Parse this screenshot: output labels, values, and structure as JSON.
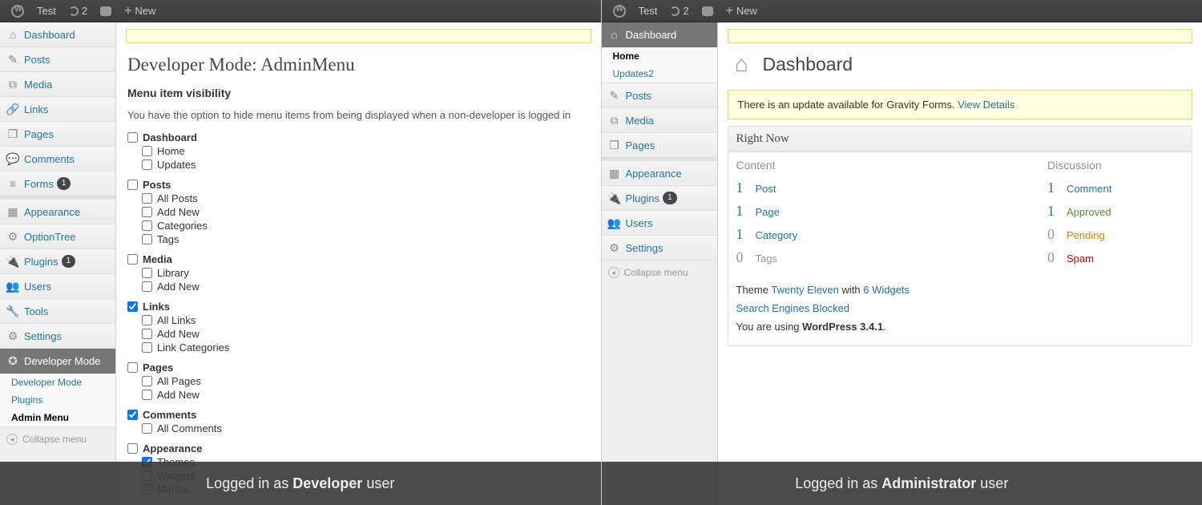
{
  "adminbar": {
    "site": "Test",
    "updates": "2",
    "new": "New"
  },
  "left": {
    "sidebar": [
      {
        "label": "Dashboard",
        "icon": "⌂",
        "badge": ""
      },
      {
        "label": "Posts",
        "icon": "✎",
        "badge": ""
      },
      {
        "label": "Media",
        "icon": "⧉",
        "badge": ""
      },
      {
        "label": "Links",
        "icon": "🔗",
        "badge": ""
      },
      {
        "label": "Pages",
        "icon": "❐",
        "badge": ""
      },
      {
        "label": "Comments",
        "icon": "💬",
        "badge": ""
      },
      {
        "label": "Forms",
        "icon": "≡",
        "badge": "1"
      },
      {
        "label": "Appearance",
        "icon": "▦",
        "badge": ""
      },
      {
        "label": "OptionTree",
        "icon": "⚙",
        "badge": ""
      },
      {
        "label": "Plugins",
        "icon": "🔌",
        "badge": "1"
      },
      {
        "label": "Users",
        "icon": "👥",
        "badge": ""
      },
      {
        "label": "Tools",
        "icon": "🔧",
        "badge": ""
      },
      {
        "label": "Settings",
        "icon": "⚙",
        "badge": ""
      },
      {
        "label": "Developer Mode",
        "icon": "✪",
        "badge": ""
      }
    ],
    "submenu": [
      "Developer Mode",
      "Plugins",
      "Admin Menu"
    ],
    "collapse": "Collapse menu",
    "page_title": "Developer Mode: AdminMenu",
    "section_title": "Menu item visibility",
    "desc": "You have the option to hide menu items from being displayed when a non-developer is logged in",
    "groups": [
      {
        "label": "Dashboard",
        "checked": false,
        "children": [
          {
            "label": "Home",
            "checked": false
          },
          {
            "label": "Updates",
            "checked": false
          }
        ]
      },
      {
        "label": "Posts",
        "checked": false,
        "children": [
          {
            "label": "All Posts",
            "checked": false
          },
          {
            "label": "Add New",
            "checked": false
          },
          {
            "label": "Categories",
            "checked": false
          },
          {
            "label": "Tags",
            "checked": false
          }
        ]
      },
      {
        "label": "Media",
        "checked": false,
        "children": [
          {
            "label": "Library",
            "checked": false
          },
          {
            "label": "Add New",
            "checked": false
          }
        ]
      },
      {
        "label": "Links",
        "checked": true,
        "children": [
          {
            "label": "All Links",
            "checked": false
          },
          {
            "label": "Add New",
            "checked": false
          },
          {
            "label": "Link Categories",
            "checked": false
          }
        ]
      },
      {
        "label": "Pages",
        "checked": false,
        "children": [
          {
            "label": "All Pages",
            "checked": false
          },
          {
            "label": "Add New",
            "checked": false
          }
        ]
      },
      {
        "label": "Comments",
        "checked": true,
        "children": [
          {
            "label": "All Comments",
            "checked": false
          }
        ]
      },
      {
        "label": "Appearance",
        "checked": false,
        "children": [
          {
            "label": "Themes",
            "checked": true
          },
          {
            "label": "Widgets",
            "checked": false
          },
          {
            "label": "Menus",
            "checked": false
          }
        ]
      }
    ],
    "overlay_prefix": "Logged in as ",
    "overlay_role": "Developer",
    "overlay_suffix": " user"
  },
  "right": {
    "sidebar": [
      {
        "label": "Dashboard",
        "icon": "⌂",
        "badge": ""
      },
      {
        "label": "Posts",
        "icon": "✎",
        "badge": ""
      },
      {
        "label": "Media",
        "icon": "⧉",
        "badge": ""
      },
      {
        "label": "Pages",
        "icon": "❐",
        "badge": ""
      },
      {
        "label": "Appearance",
        "icon": "▦",
        "badge": ""
      },
      {
        "label": "Plugins",
        "icon": "🔌",
        "badge": "1"
      },
      {
        "label": "Users",
        "icon": "👥",
        "badge": ""
      },
      {
        "label": "Settings",
        "icon": "⚙",
        "badge": ""
      }
    ],
    "dash_sub": [
      {
        "label": "Home",
        "badge": ""
      },
      {
        "label": "Updates",
        "badge": "2"
      }
    ],
    "collapse": "Collapse menu",
    "page_title": "Dashboard",
    "notice_text": "There is an update available for Gravity Forms. ",
    "notice_link": "View Details",
    "rightnow": {
      "title": "Right Now",
      "content_h": "Content",
      "discussion_h": "Discussion",
      "content": [
        {
          "n": "1",
          "label": "Post"
        },
        {
          "n": "1",
          "label": "Page"
        },
        {
          "n": "1",
          "label": "Category"
        },
        {
          "n": "0",
          "label": "Tags"
        }
      ],
      "discussion": [
        {
          "n": "1",
          "label": "Comment",
          "cls": ""
        },
        {
          "n": "1",
          "label": "Approved",
          "cls": "green"
        },
        {
          "n": "0",
          "label": "Pending",
          "cls": "orange"
        },
        {
          "n": "0",
          "label": "Spam",
          "cls": "red"
        }
      ],
      "theme_prefix": "Theme ",
      "theme_name": "Twenty Eleven",
      "theme_mid": " with ",
      "theme_widgets": "6 Widgets",
      "search": "Search Engines Blocked",
      "version_prefix": "You are using ",
      "version": "WordPress 3.4.1",
      "version_suffix": "."
    },
    "overlay_prefix": "Logged in as ",
    "overlay_role": "Administrator",
    "overlay_suffix": " user"
  }
}
